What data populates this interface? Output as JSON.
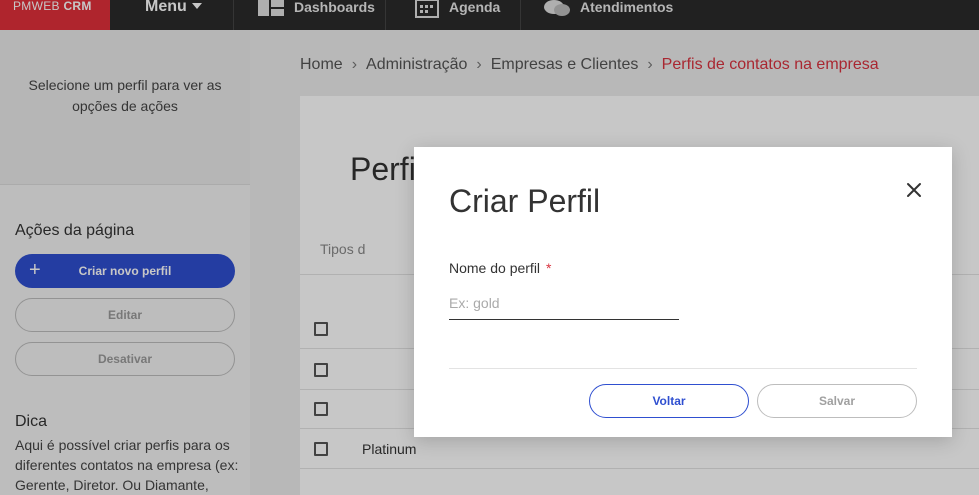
{
  "topbar": {
    "brand_part1": "PMWEB ",
    "brand_part2": "CRM",
    "menu_label": "Menu",
    "nav": [
      {
        "label": "Dashboards",
        "icon": "dashboard-icon"
      },
      {
        "label": "Agenda",
        "icon": "calendar-icon"
      },
      {
        "label": "Atendimentos",
        "icon": "chat-icon"
      }
    ]
  },
  "sidebar": {
    "hint": "Selecione um perfil para ver as opções de ações",
    "section_title": "Ações da página",
    "create_label": "Criar novo perfil",
    "edit_label": "Editar",
    "deactivate_label": "Desativar",
    "tip_title": "Dica",
    "tip_text": "Aqui é possível criar perfis para os diferentes contatos na empresa (ex: Gerente, Diretor. Ou Diamante,"
  },
  "breadcrumb": {
    "items": [
      "Home",
      "Administração",
      "Empresas e Clientes"
    ],
    "current": "Perfis de contatos na empresa",
    "separator": "›"
  },
  "main": {
    "title": "Perfis",
    "types_label": "Tipos d",
    "rows": [
      "",
      "",
      "",
      "Platinum"
    ]
  },
  "modal": {
    "title": "Criar Perfil",
    "field_label": "Nome do perfil",
    "required_mark": "*",
    "field_placeholder": "Ex: gold",
    "field_value": "",
    "back_label": "Voltar",
    "save_label": "Salvar"
  },
  "colors": {
    "brand": "#e0303a",
    "primary": "#2f4fd0",
    "breadcrumb_current": "#d9333f",
    "topbar": "#2b2b2b"
  }
}
